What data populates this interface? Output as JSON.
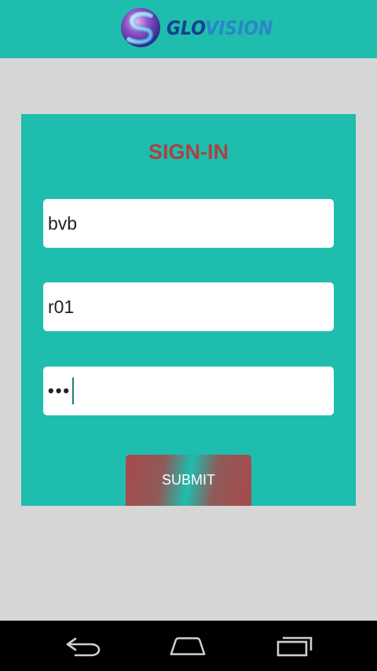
{
  "header": {
    "logo_glo": "GLO",
    "logo_vision": "VISION",
    "logo_icon": "glovision-s-logo-icon"
  },
  "form": {
    "title": "SIGN-IN",
    "field1_value": "bvb",
    "field2_value": "r01",
    "password_mask": "•••",
    "submit_label": "SUBMIT"
  },
  "navbar": {
    "icons": [
      "back-icon",
      "home-icon",
      "recent-apps-icon"
    ]
  },
  "colors": {
    "teal": "#1fbdae",
    "background": "#d6d6d6",
    "title_red": "#a94343"
  }
}
